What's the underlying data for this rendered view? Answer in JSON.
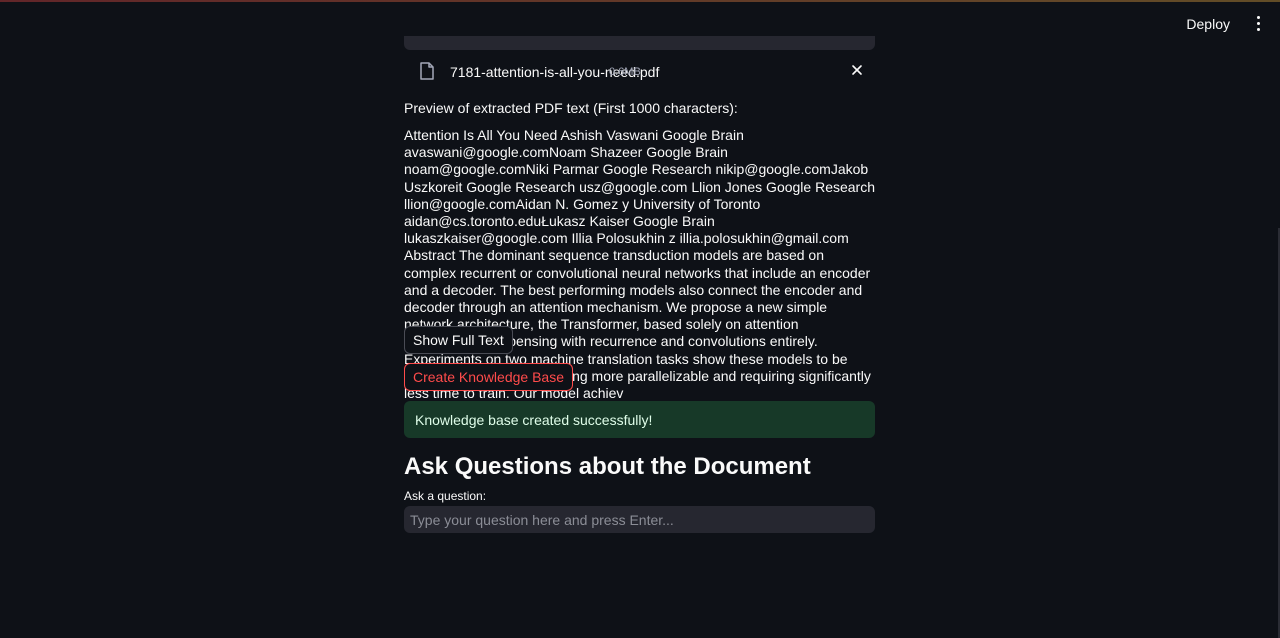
{
  "header": {
    "deploy_label": "Deploy",
    "menu_icon": "more-vertical-icon"
  },
  "uploader": {
    "file_name": "7181-attention-is-all-you-need.pdf",
    "file_size": "0.6MB",
    "file_icon": "file-icon",
    "close_icon": "close-icon"
  },
  "preview": {
    "label": "Preview of extracted PDF text (First 1000 characters):",
    "text": "Attention Is All You Need Ashish Vaswani  Google Brain avaswani@google.comNoam Shazeer  Google Brain noam@google.comNiki Parmar  Google Research nikip@google.comJakob Uszkoreit  Google Research usz@google.com Llion Jones  Google Research llion@google.comAidan N. Gomez  y University of Toronto aidan@cs.toronto.eduŁukasz Kaiser  Google Brain lukaszkaiser@google.com Illia Polosukhin  z illia.polosukhin@gmail.com Abstract The dominant sequence transduction models are based on complex recurrent or convolutional neural networks that include an encoder and a decoder. The best performing models also connect the encoder and decoder through an attention mechanism. We propose a new simple network architecture, the Transformer, based solely on attention mechanisms, dispensing with recurrence and convolutions entirely. Experiments on two machine translation tasks show these models to be superior in quality while being more parallelizable and requiring significantly less time to train. Our model achiev"
  },
  "buttons": {
    "show_full_text": "Show Full Text",
    "create_kb": "Create Knowledge Base"
  },
  "alert": {
    "success": "Knowledge base created successfully!"
  },
  "qa": {
    "title": "Ask Questions about the Document",
    "label": "Ask a question:",
    "placeholder": "Type your question here and press Enter..."
  },
  "colors": {
    "background": "#0e1117",
    "accent": "#ff4b4b",
    "success_bg": "#173928",
    "input_bg": "#262730"
  }
}
